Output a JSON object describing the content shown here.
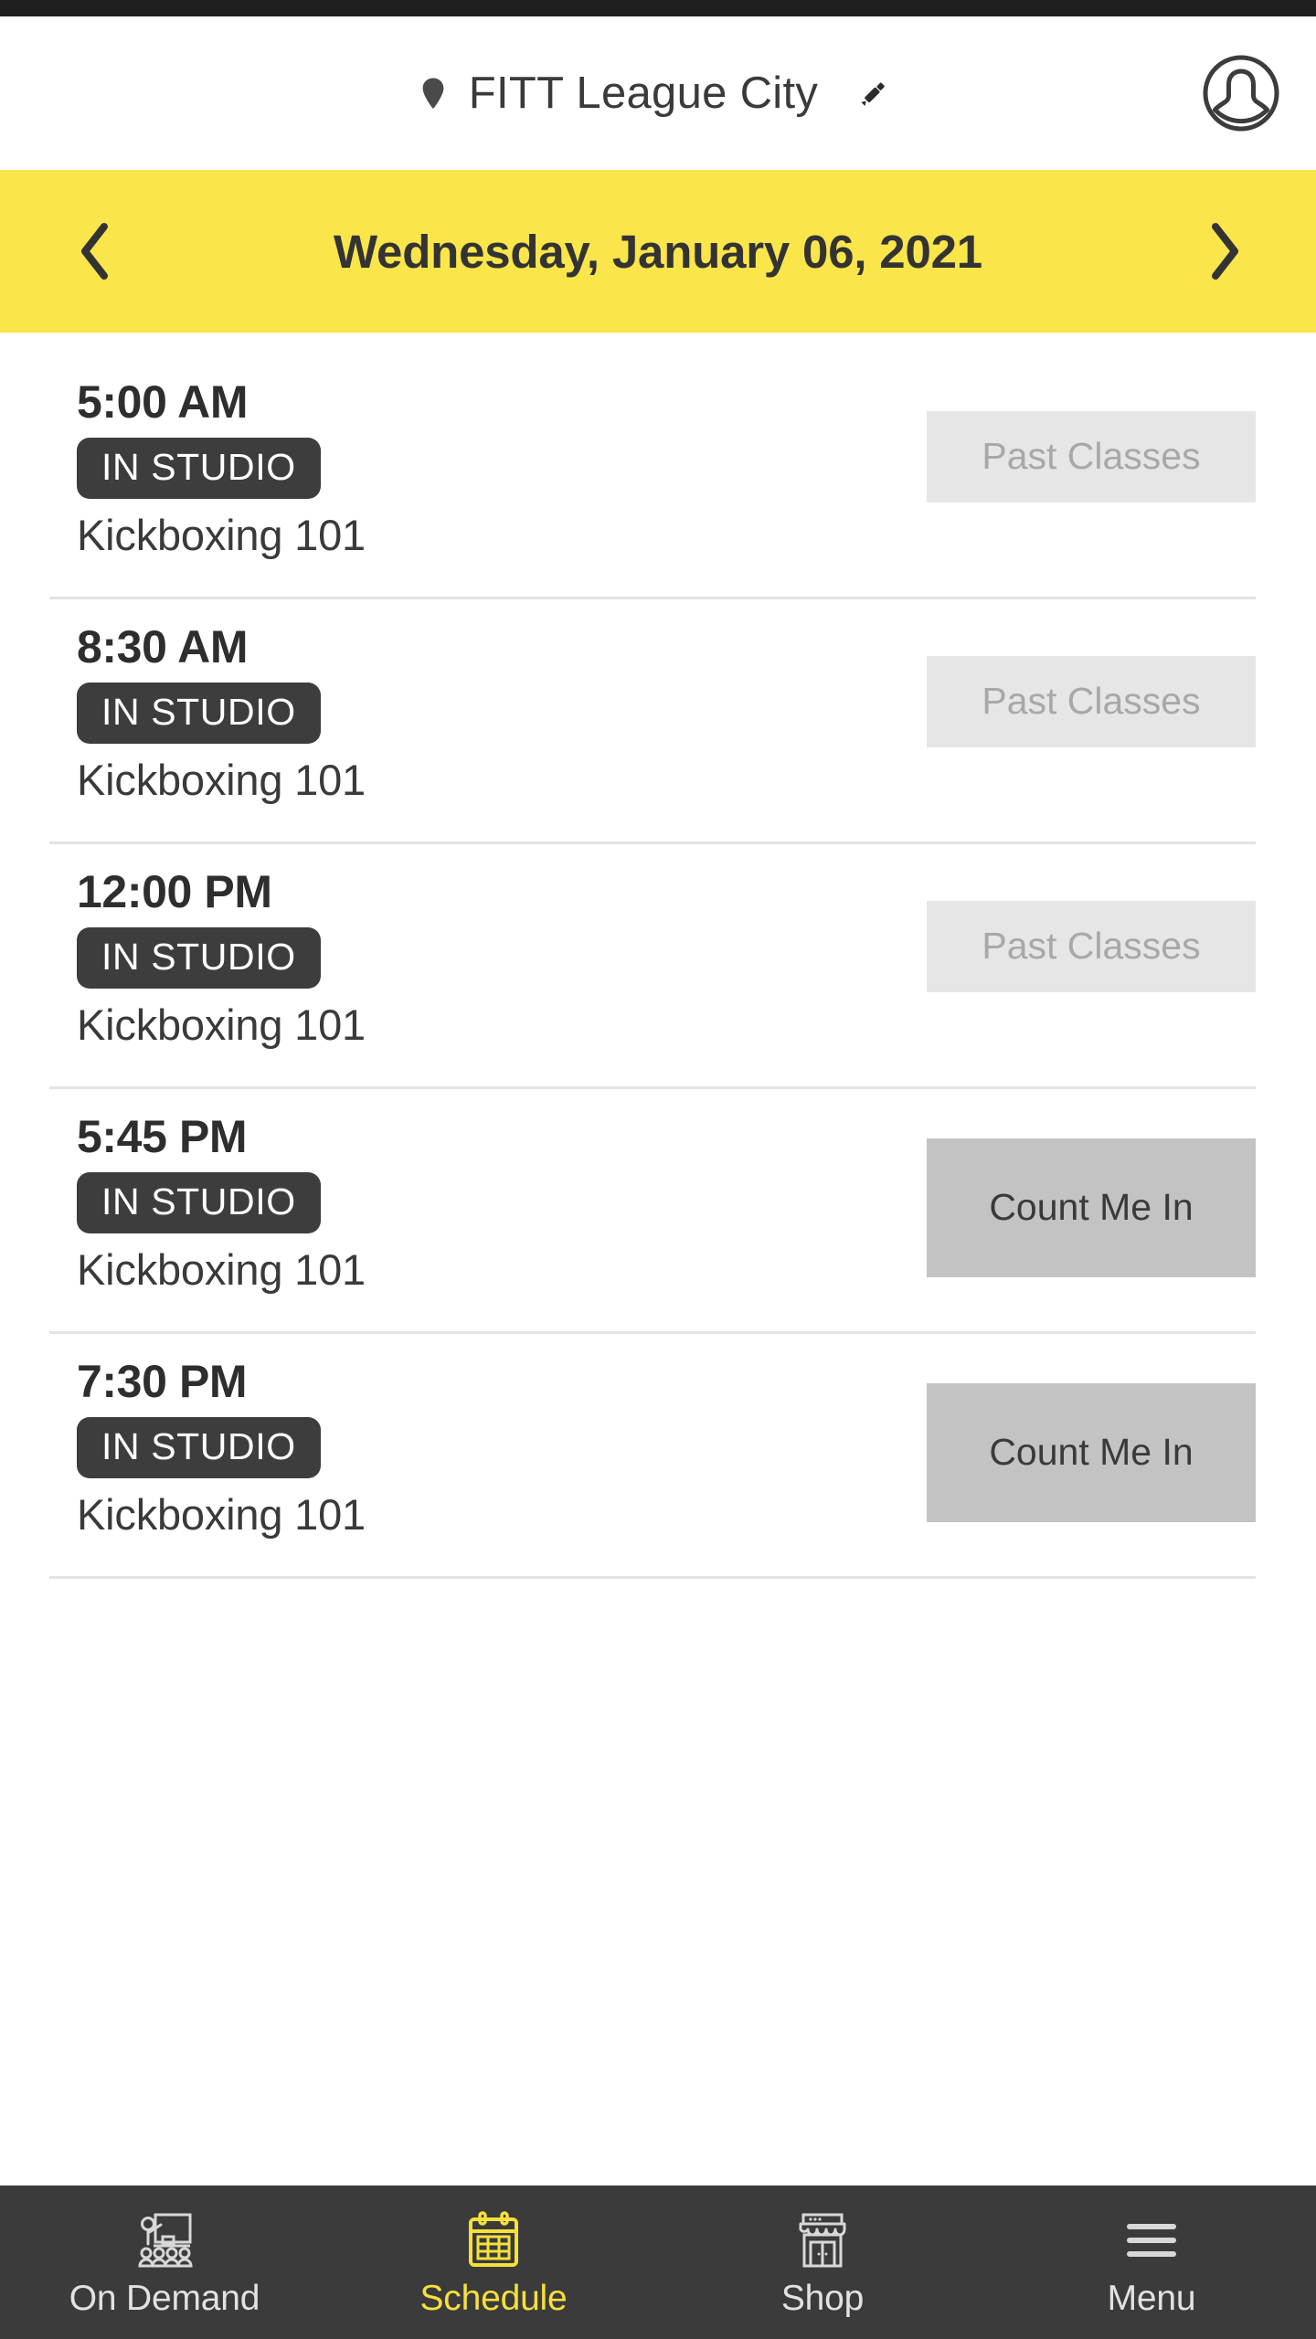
{
  "status_bar": {
    "background": "#1f1f1f"
  },
  "header": {
    "location_icon": "map-pin-icon",
    "title": "FITT League City",
    "edit_icon": "pencil-icon",
    "profile_icon": "user-avatar-icon"
  },
  "date_bar": {
    "background": "#fae54a",
    "prev_icon": "chevron-left-icon",
    "next_icon": "chevron-right-icon",
    "date": "Wednesday, January 06, 2021"
  },
  "schedule": {
    "rows": [
      {
        "time": "5:00 AM",
        "badge": "IN STUDIO",
        "name": "Kickboxing 101",
        "action": "Past Classes",
        "action_state": "past"
      },
      {
        "time": "8:30 AM",
        "badge": "IN STUDIO",
        "name": "Kickboxing 101",
        "action": "Past Classes",
        "action_state": "past"
      },
      {
        "time": "12:00 PM",
        "badge": "IN STUDIO",
        "name": "Kickboxing 101",
        "action": "Past Classes",
        "action_state": "past"
      },
      {
        "time": "5:45 PM",
        "badge": "IN STUDIO",
        "name": "Kickboxing 101",
        "action": "Count Me In",
        "action_state": "book"
      },
      {
        "time": "7:30 PM",
        "badge": "IN STUDIO",
        "name": "Kickboxing 101",
        "action": "Count Me In",
        "action_state": "book"
      }
    ]
  },
  "bottom_nav": {
    "active": "Schedule",
    "active_color": "#f5e03c",
    "items": [
      {
        "label": "On Demand",
        "icon": "classroom-presentation-icon",
        "active": false
      },
      {
        "label": "Schedule",
        "icon": "calendar-icon",
        "active": true
      },
      {
        "label": "Shop",
        "icon": "storefront-icon",
        "active": false
      },
      {
        "label": "Menu",
        "icon": "hamburger-menu-icon",
        "active": false
      }
    ]
  },
  "colors": {
    "accent_yellow": "#fae54a",
    "badge_dark": "#3d3d3d",
    "nav_dark": "#3b3b3b",
    "past_button": "#e6e6e6",
    "book_button": "#c3c3c3"
  }
}
